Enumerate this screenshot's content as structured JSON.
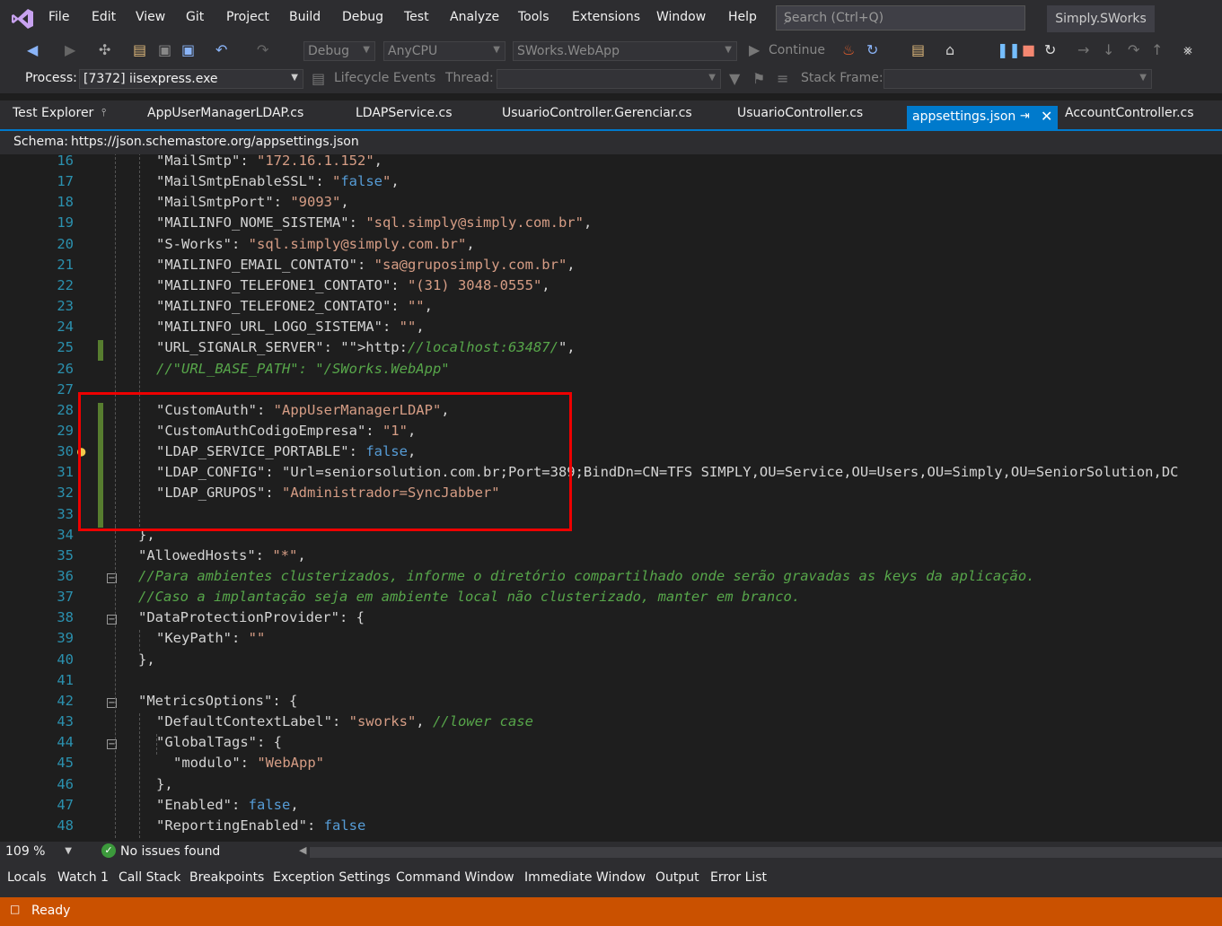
{
  "menubar": {
    "items": [
      "File",
      "Edit",
      "View",
      "Git",
      "Project",
      "Build",
      "Debug",
      "Test",
      "Analyze",
      "Tools",
      "Extensions",
      "Window",
      "Help"
    ],
    "search_placeholder": "Search (Ctrl+Q)",
    "solution_name": "Simply.SWorks"
  },
  "toolbar": {
    "config": "Debug",
    "platform": "AnyCPU",
    "startup_project": "SWorks.WebApp",
    "continue_label": "Continue",
    "process_label": "Process:",
    "process_value": "[7372] iisexpress.exe",
    "lifecycle_label": "Lifecycle Events",
    "thread_label": "Thread:",
    "stack_frame_label": "Stack Frame:"
  },
  "tabs": {
    "test_explorer": "Test Explorer",
    "docs": [
      "AppUserManagerLDAP.cs",
      "LDAPService.cs",
      "UsuarioController.Gerenciar.cs",
      "UsuarioController.cs"
    ],
    "active": "appsettings.json",
    "after": "AccountController.cs"
  },
  "schema": {
    "label": "Schema:",
    "url": "https://json.schemastore.org/appsettings.json"
  },
  "code_lines": [
    {
      "n": "16",
      "t": "\"MailSmtp\": \"172.16.1.152\","
    },
    {
      "n": "17",
      "t": "\"MailSmtpEnableSSL\": \"false\","
    },
    {
      "n": "18",
      "t": "\"MailSmtpPort\": \"9093\","
    },
    {
      "n": "19",
      "t": "\"MAILINFO_NOME_SISTEMA\": \"sql.simply@simply.com.br\","
    },
    {
      "n": "20",
      "t": "\"S-Works\": \"sql.simply@simply.com.br\","
    },
    {
      "n": "21",
      "t": "\"MAILINFO_EMAIL_CONTATO\": \"sa@gruposimply.com.br\","
    },
    {
      "n": "22",
      "t": "\"MAILINFO_TELEFONE1_CONTATO\": \"(31) 3048-0555\","
    },
    {
      "n": "23",
      "t": "\"MAILINFO_TELEFONE2_CONTATO\": \"\","
    },
    {
      "n": "24",
      "t": "\"MAILINFO_URL_LOGO_SISTEMA\": \"\","
    },
    {
      "n": "25",
      "t": "\"URL_SIGNALR_SERVER\": \"http://localhost:63487/\","
    },
    {
      "n": "26",
      "t": "//\"URL_BASE_PATH\": \"/SWorks.WebApp\""
    },
    {
      "n": "27",
      "t": ""
    },
    {
      "n": "28",
      "t": "\"CustomAuth\": \"AppUserManagerLDAP\","
    },
    {
      "n": "29",
      "t": "\"CustomAuthCodigoEmpresa\": \"1\","
    },
    {
      "n": "30",
      "t": "\"LDAP_SERVICE_PORTABLE\": false,"
    },
    {
      "n": "31",
      "t": "\"LDAP_CONFIG\": \"Url=seniorsolution.com.br;Port=389;BindDn=CN=TFS SIMPLY,OU=Service,OU=Users,OU=Simply,OU=SeniorSolution,DC"
    },
    {
      "n": "32",
      "t": "\"LDAP_GRUPOS\": \"Administrador=SyncJabber\""
    },
    {
      "n": "33",
      "t": ""
    },
    {
      "n": "34",
      "t": "},"
    },
    {
      "n": "35",
      "t": "\"AllowedHosts\": \"*\","
    },
    {
      "n": "36",
      "t": "//Para ambientes clusterizados, informe o diretório compartilhado onde serão gravadas as keys da aplicação."
    },
    {
      "n": "37",
      "t": "//Caso a implantação seja em ambiente local não clusterizado, manter em branco."
    },
    {
      "n": "38",
      "t": "\"DataProtectionProvider\": {"
    },
    {
      "n": "39",
      "t": "\"KeyPath\": \"\""
    },
    {
      "n": "40",
      "t": "},"
    },
    {
      "n": "41",
      "t": ""
    },
    {
      "n": "42",
      "t": "\"MetricsOptions\": {"
    },
    {
      "n": "43",
      "t": "\"DefaultContextLabel\": \"sworks\", //lower case"
    },
    {
      "n": "44",
      "t": "\"GlobalTags\": {"
    },
    {
      "n": "45",
      "t": "\"modulo\": \"WebApp\""
    },
    {
      "n": "46",
      "t": "},"
    },
    {
      "n": "47",
      "t": "\"Enabled\": false,"
    },
    {
      "n": "48",
      "t": "\"ReportingEnabled\": false"
    }
  ],
  "editor_status": {
    "zoom": "109 %",
    "issues": "No issues found"
  },
  "tool_windows": [
    "Locals",
    "Watch 1",
    "Call Stack",
    "Breakpoints",
    "Exception Settings",
    "Command Window",
    "Immediate Window",
    "Output",
    "Error List"
  ],
  "statusbar": {
    "text": "Ready"
  },
  "colors": {
    "accent": "#007acc",
    "status": "#ca5100",
    "highlight_box": "#e00000"
  }
}
